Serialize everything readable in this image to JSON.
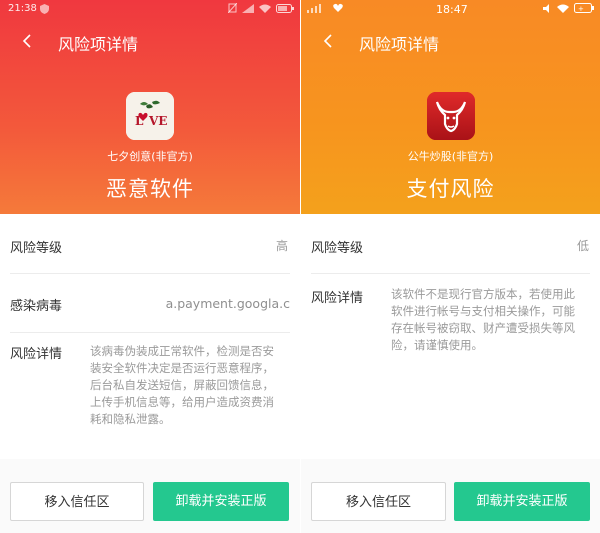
{
  "left": {
    "status": {
      "time": "21:38"
    },
    "nav": {
      "title": "风险项详情"
    },
    "app": {
      "icon_text": "LOVE",
      "name": "七夕创意(非官方)",
      "risk_type": "恶意软件"
    },
    "rows": {
      "level_label": "风险等级",
      "level_value": "高",
      "virus_label": "感染病毒",
      "virus_value": "a.payment.googla.c",
      "detail_label": "风险详情",
      "detail_lines": [
        "该病毒伪装成正常软件，检测是否安",
        "装安全软件决定是否运行恶意程序，",
        "后台私自发送短信，屏蔽回馈信息，",
        "上传手机信息等，给用户造成资费消",
        "耗和隐私泄露。"
      ]
    },
    "buttons": {
      "trust": "移入信任区",
      "reinstall": "卸载并安装正版"
    }
  },
  "right": {
    "status": {
      "time": "18:47"
    },
    "nav": {
      "title": "风险项详情"
    },
    "app": {
      "name": "公牛炒股(非官方)",
      "risk_type": "支付风险"
    },
    "rows": {
      "level_label": "风险等级",
      "level_value": "低",
      "detail_label": "风险详情",
      "detail_lines": [
        "该软件不是现行官方版本，若使用此",
        "软件进行帐号与支付相关操作，可能",
        "存在帐号被窃取、财产遭受损失等风",
        "险，请谨慎使用。"
      ]
    },
    "buttons": {
      "trust": "移入信任区",
      "reinstall": "卸载并安装正版"
    }
  },
  "colors": {
    "danger_header": "#f0383f",
    "warning_header": "#f7951e",
    "primary_button": "#24c88f"
  }
}
